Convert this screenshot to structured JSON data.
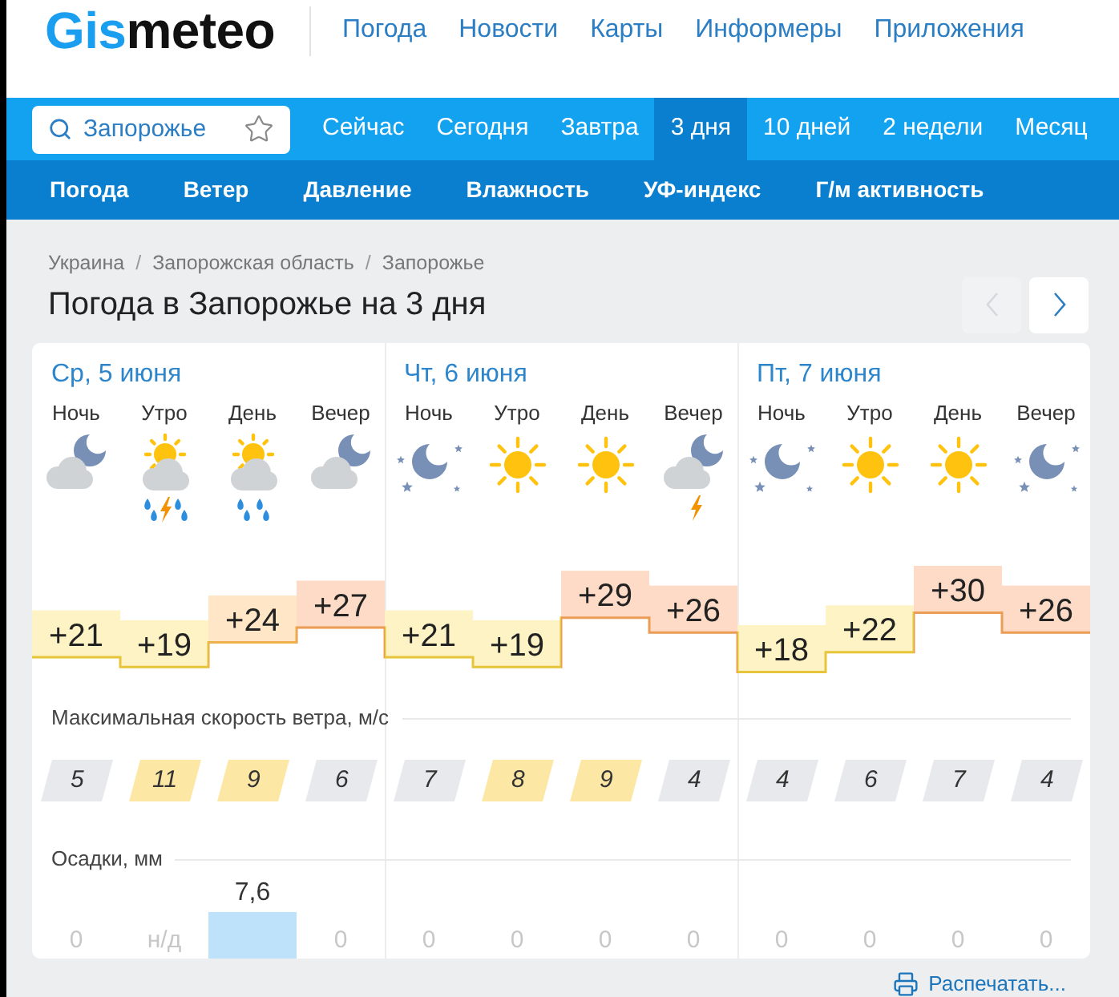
{
  "header": {
    "logo": {
      "accent": "Gis",
      "rest": "meteo"
    },
    "nav": [
      "Погода",
      "Новости",
      "Карты",
      "Информеры",
      "Приложения"
    ]
  },
  "search": {
    "value": "Запорожье",
    "starred": false
  },
  "tabs": [
    {
      "label": "Сейчас",
      "selected": false
    },
    {
      "label": "Сегодня",
      "selected": false
    },
    {
      "label": "Завтра",
      "selected": false
    },
    {
      "label": "3 дня",
      "selected": true
    },
    {
      "label": "10 дней",
      "selected": false
    },
    {
      "label": "2 недели",
      "selected": false
    },
    {
      "label": "Месяц",
      "selected": false
    }
  ],
  "subnav": [
    "Погода",
    "Ветер",
    "Давление",
    "Влажность",
    "УФ-индекс",
    "Г/м активность"
  ],
  "breadcrumbs": [
    {
      "kind": "link",
      "text": "Украина"
    },
    {
      "kind": "separator",
      "text": "/"
    },
    {
      "kind": "link",
      "text": "Запорожская область"
    },
    {
      "kind": "separator",
      "text": "/"
    },
    {
      "kind": "link",
      "text": "Запорожье"
    }
  ],
  "title": "Погода в Запорожье на 3 дня",
  "pager": [
    {
      "kind": "prev",
      "disabled": true
    },
    {
      "kind": "next",
      "disabled": false
    }
  ],
  "days": [
    {
      "date": "Ср, 5 июня",
      "periods": [
        {
          "label": "Ночь",
          "moon": true,
          "cloud": true,
          "rain": false,
          "thunder": false
        },
        {
          "label": "Утро",
          "moon": false,
          "cloud": true,
          "rain": true,
          "thunder": true
        },
        {
          "label": "День",
          "moon": false,
          "cloud": true,
          "rain": true,
          "thunder": false
        },
        {
          "label": "Вечер",
          "moon": true,
          "cloud": true,
          "rain": false,
          "thunder": false
        }
      ]
    },
    {
      "date": "Чт, 6 июня",
      "periods": [
        {
          "label": "Ночь",
          "moon": true,
          "cloud": false,
          "rain": false,
          "thunder": false
        },
        {
          "label": "Утро",
          "moon": false,
          "cloud": false,
          "rain": false,
          "thunder": false
        },
        {
          "label": "День",
          "moon": false,
          "cloud": false,
          "rain": false,
          "thunder": false
        },
        {
          "label": "Вечер",
          "moon": true,
          "cloud": true,
          "rain": false,
          "thunder": true
        }
      ]
    },
    {
      "date": "Пт, 7 июня",
      "periods": [
        {
          "label": "Ночь",
          "moon": true,
          "cloud": false,
          "rain": false,
          "thunder": false
        },
        {
          "label": "Утро",
          "moon": false,
          "cloud": false,
          "rain": false,
          "thunder": false
        },
        {
          "label": "День",
          "moon": false,
          "cloud": false,
          "rain": false,
          "thunder": false
        },
        {
          "label": "Вечер",
          "moon": true,
          "cloud": false,
          "rain": false,
          "thunder": false
        }
      ]
    }
  ],
  "temperatures": [
    "+21",
    "+19",
    "+24",
    "+27",
    "+21",
    "+19",
    "+29",
    "+26",
    "+18",
    "+22",
    "+30",
    "+26"
  ],
  "wind": {
    "title": "Максимальная скорость ветра, м/с",
    "values": [
      {
        "text": "5",
        "color": "#e8e9ec"
      },
      {
        "text": "11",
        "color": "#fde7a4"
      },
      {
        "text": "9",
        "color": "#fde7a4"
      },
      {
        "text": "6",
        "color": "#e8e9ec"
      },
      {
        "text": "7",
        "color": "#e8e9ec"
      },
      {
        "text": "8",
        "color": "#fde7a4"
      },
      {
        "text": "9",
        "color": "#fde7a4"
      },
      {
        "text": "4",
        "color": "#e8e9ec"
      },
      {
        "text": "4",
        "color": "#e8e9ec"
      },
      {
        "text": "6",
        "color": "#e8e9ec"
      },
      {
        "text": "7",
        "color": "#e8e9ec"
      },
      {
        "text": "4",
        "color": "#e8e9ec"
      }
    ]
  },
  "precipitation": {
    "title": "Осадки, мм",
    "values": [
      "0",
      "н/д",
      "7,6",
      "0",
      "0",
      "0",
      "0",
      "0",
      "0",
      "0",
      "0",
      "0"
    ]
  },
  "print_link": "Распечатать..."
}
